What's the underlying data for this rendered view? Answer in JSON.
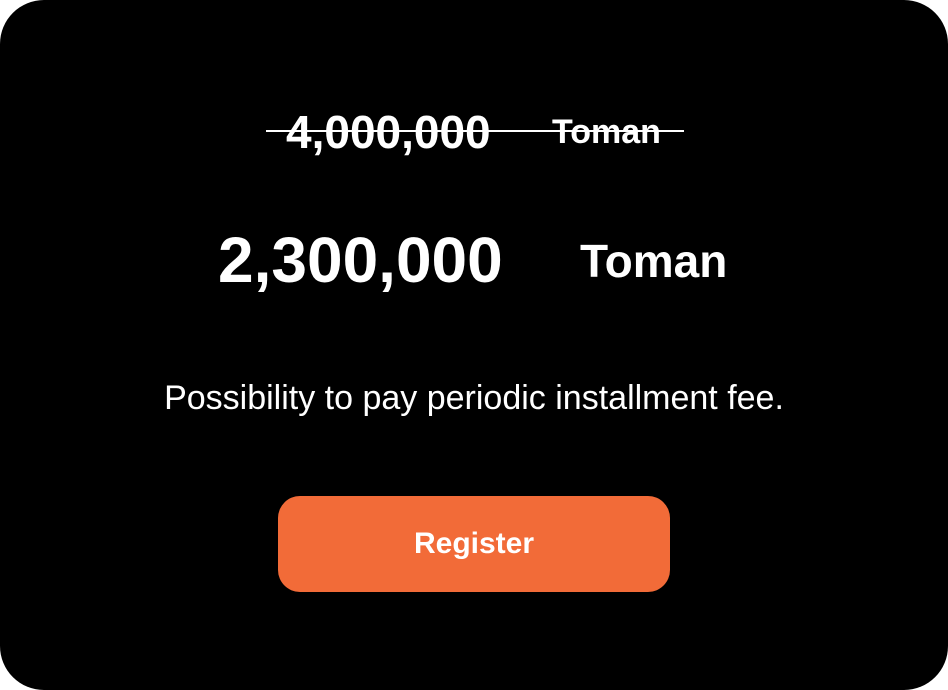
{
  "pricing": {
    "old_price": {
      "amount": "4,000,000",
      "currency": "Toman"
    },
    "new_price": {
      "amount": "2,300,000",
      "currency": "Toman"
    },
    "note": "Possibility to pay periodic installment fee.",
    "register_label": "Register"
  },
  "colors": {
    "background": "#000000",
    "text": "#FFFFFF",
    "accent": "#F26B38"
  }
}
